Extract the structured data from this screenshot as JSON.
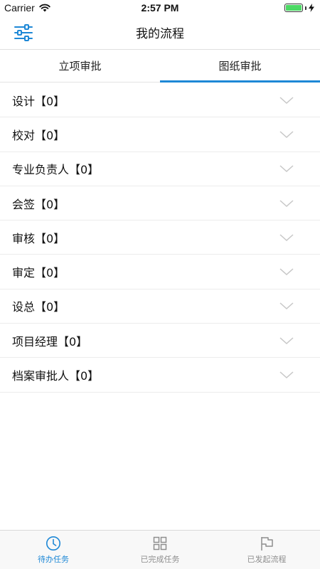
{
  "status_bar": {
    "carrier": "Carrier",
    "time": "2:57 PM"
  },
  "nav": {
    "title": "我的流程",
    "filter_icon": "sliders-icon"
  },
  "tabs": [
    {
      "label": "立项审批",
      "active": false
    },
    {
      "label": "图纸审批",
      "active": true
    }
  ],
  "list": {
    "items": [
      {
        "label": "设计【0】"
      },
      {
        "label": "校对【0】"
      },
      {
        "label": "专业负责人【0】"
      },
      {
        "label": "会签【0】"
      },
      {
        "label": "审核【0】"
      },
      {
        "label": "审定【0】"
      },
      {
        "label": "设总【0】"
      },
      {
        "label": "项目经理【0】"
      },
      {
        "label": "档案审批人【0】"
      }
    ]
  },
  "tab_bar": {
    "items": [
      {
        "label": "待办任务",
        "icon": "clock-icon",
        "active": true
      },
      {
        "label": "已完成任务",
        "icon": "grid-icon",
        "active": false
      },
      {
        "label": "已发起流程",
        "icon": "flag-icon",
        "active": false
      }
    ]
  },
  "colors": {
    "accent": "#1e88d6",
    "inactive": "#8e8e8e",
    "battery": "#4cd964"
  }
}
